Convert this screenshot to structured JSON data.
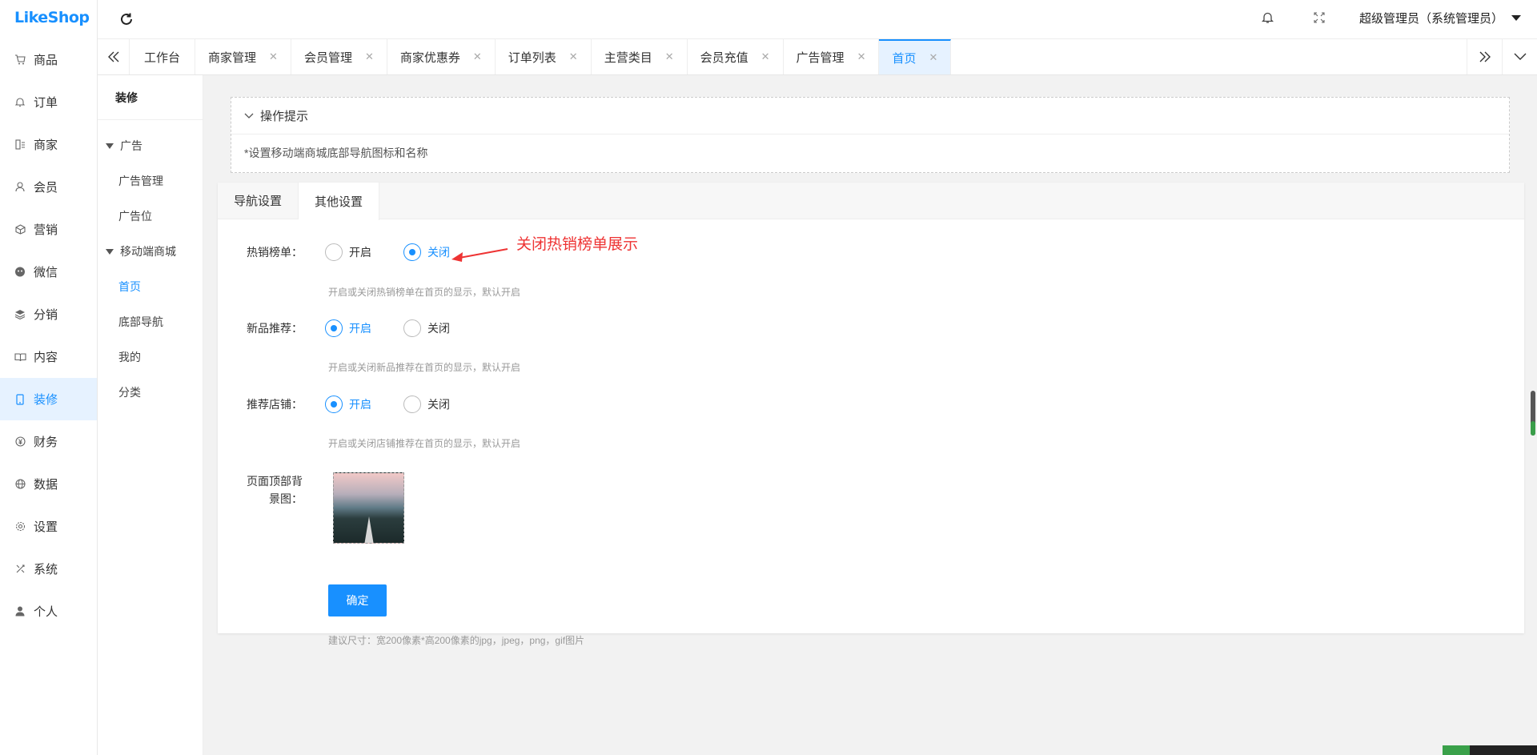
{
  "app": {
    "logo_text": "LikeShop"
  },
  "header": {
    "user_label": "超级管理员（系统管理员）"
  },
  "sidebar": {
    "items": [
      {
        "label": "商品",
        "icon": "cart-icon"
      },
      {
        "label": "订单",
        "icon": "bell-icon"
      },
      {
        "label": "商家",
        "icon": "store-icon"
      },
      {
        "label": "会员",
        "icon": "user-icon"
      },
      {
        "label": "营销",
        "icon": "box-icon"
      },
      {
        "label": "微信",
        "icon": "wechat-icon"
      },
      {
        "label": "分销",
        "icon": "layers-icon"
      },
      {
        "label": "内容",
        "icon": "book-icon"
      },
      {
        "label": "装修",
        "icon": "mobile-icon",
        "active": true
      },
      {
        "label": "财务",
        "icon": "yen-icon"
      },
      {
        "label": "数据",
        "icon": "globe-icon"
      },
      {
        "label": "设置",
        "icon": "gear-icon"
      },
      {
        "label": "系统",
        "icon": "tools-icon"
      },
      {
        "label": "个人",
        "icon": "person-icon"
      }
    ]
  },
  "tabs": {
    "items": [
      {
        "label": "工作台",
        "closable": false
      },
      {
        "label": "商家管理",
        "closable": true
      },
      {
        "label": "会员管理",
        "closable": true
      },
      {
        "label": "商家优惠券",
        "closable": true
      },
      {
        "label": "订单列表",
        "closable": true
      },
      {
        "label": "主营类目",
        "closable": true
      },
      {
        "label": "会员充值",
        "closable": true
      },
      {
        "label": "广告管理",
        "closable": true
      },
      {
        "label": "首页",
        "closable": true,
        "active": true
      }
    ]
  },
  "subside": {
    "title": "装修",
    "groups": [
      {
        "label": "广告",
        "items": [
          "广告管理",
          "广告位"
        ]
      },
      {
        "label": "移动端商城",
        "items": [
          "首页",
          "底部导航",
          "我的",
          "分类"
        ]
      }
    ],
    "active_item": "首页"
  },
  "tip": {
    "title": "操作提示",
    "text": "*设置移动端商城底部导航图标和名称"
  },
  "panel": {
    "tabs": [
      "导航设置",
      "其他设置"
    ],
    "active_tab": "其他设置",
    "hot": {
      "label": "热销榜单：",
      "on": "开启",
      "off": "关闭",
      "selected": "关闭",
      "hint": "开启或关闭热销榜单在首页的显示，默认开启"
    },
    "newp": {
      "label": "新品推荐：",
      "on": "开启",
      "off": "关闭",
      "selected": "开启",
      "hint": "开启或关闭新品推荐在首页的显示，默认开启"
    },
    "shop": {
      "label": "推荐店铺：",
      "on": "开启",
      "off": "关闭",
      "selected": "开启",
      "hint": "开启或关闭店铺推荐在首页的显示，默认开启"
    },
    "bg": {
      "label_line1": "页面顶部背",
      "label_line2": "景图：",
      "hint": "建议尺寸：宽200像素*高200像素的jpg，jpeg，png，gif图片"
    },
    "submit_label": "确定"
  },
  "annotation": {
    "text": "关闭热销榜单展示",
    "color": "#ee3333"
  },
  "colors": {
    "accent": "#1890ff",
    "active_bg": "#e6f2ff"
  }
}
